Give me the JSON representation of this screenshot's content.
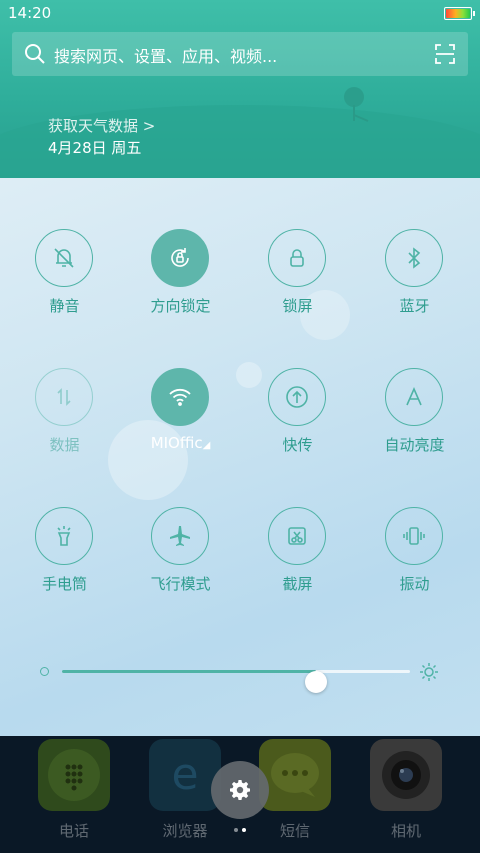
{
  "status": {
    "time": "14:20",
    "battery_level": 1.0
  },
  "search": {
    "placeholder": "搜索网页、设置、应用、视频..."
  },
  "weather": {
    "link": "获取天气数据 >",
    "date": "4月28日 周五"
  },
  "toggles": [
    {
      "label": "静音",
      "icon": "bell-muted-icon",
      "state": "off"
    },
    {
      "label": "方向锁定",
      "icon": "rotation-lock-icon",
      "state": "on"
    },
    {
      "label": "锁屏",
      "icon": "lock-icon",
      "state": "off"
    },
    {
      "label": "蓝牙",
      "icon": "bluetooth-icon",
      "state": "off"
    },
    {
      "label": "数据",
      "icon": "data-arrows-icon",
      "state": "disabled"
    },
    {
      "label": "MIOffic",
      "icon": "wifi-icon",
      "state": "on"
    },
    {
      "label": "快传",
      "icon": "upload-icon",
      "state": "off"
    },
    {
      "label": "自动亮度",
      "icon": "auto-brightness-icon",
      "state": "off"
    },
    {
      "label": "手电筒",
      "icon": "flashlight-icon",
      "state": "off"
    },
    {
      "label": "飞行模式",
      "icon": "airplane-icon",
      "state": "off"
    },
    {
      "label": "截屏",
      "icon": "scissors-icon",
      "state": "off"
    },
    {
      "label": "振动",
      "icon": "vibrate-icon",
      "state": "off"
    }
  ],
  "brightness": {
    "level": 0.73
  },
  "dock": [
    {
      "label": "电话",
      "icon": "phone-app-icon"
    },
    {
      "label": "浏览器",
      "icon": "browser-app-icon"
    },
    {
      "label": "短信",
      "icon": "messages-app-icon"
    },
    {
      "label": "相机",
      "icon": "camera-app-icon"
    }
  ],
  "colors": {
    "accent": "#4fb3a6",
    "header": "#2fae9b"
  }
}
